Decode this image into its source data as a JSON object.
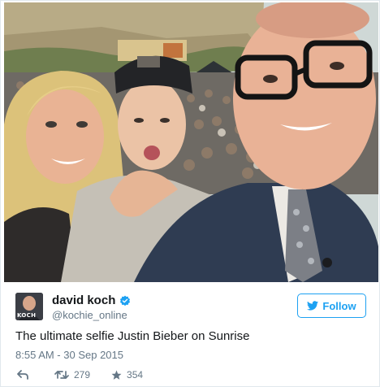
{
  "tweet": {
    "author": {
      "display_name": "david koch",
      "handle": "@kochie_online",
      "avatar_text": "KOCH",
      "verified": true
    },
    "follow_label": "Follow",
    "text": "The ultimate selfie Justin Bieber on Sunrise",
    "timestamp": "8:55 AM - 30 Sep 2015",
    "retweet_count": "279",
    "like_count": "354"
  },
  "icons": [
    "reply-icon",
    "retweet-icon",
    "like-icon",
    "verified-icon",
    "twitter-bird-icon"
  ],
  "colors": {
    "accent": "#1da1f2",
    "text": "#14171a",
    "muted": "#657786"
  }
}
